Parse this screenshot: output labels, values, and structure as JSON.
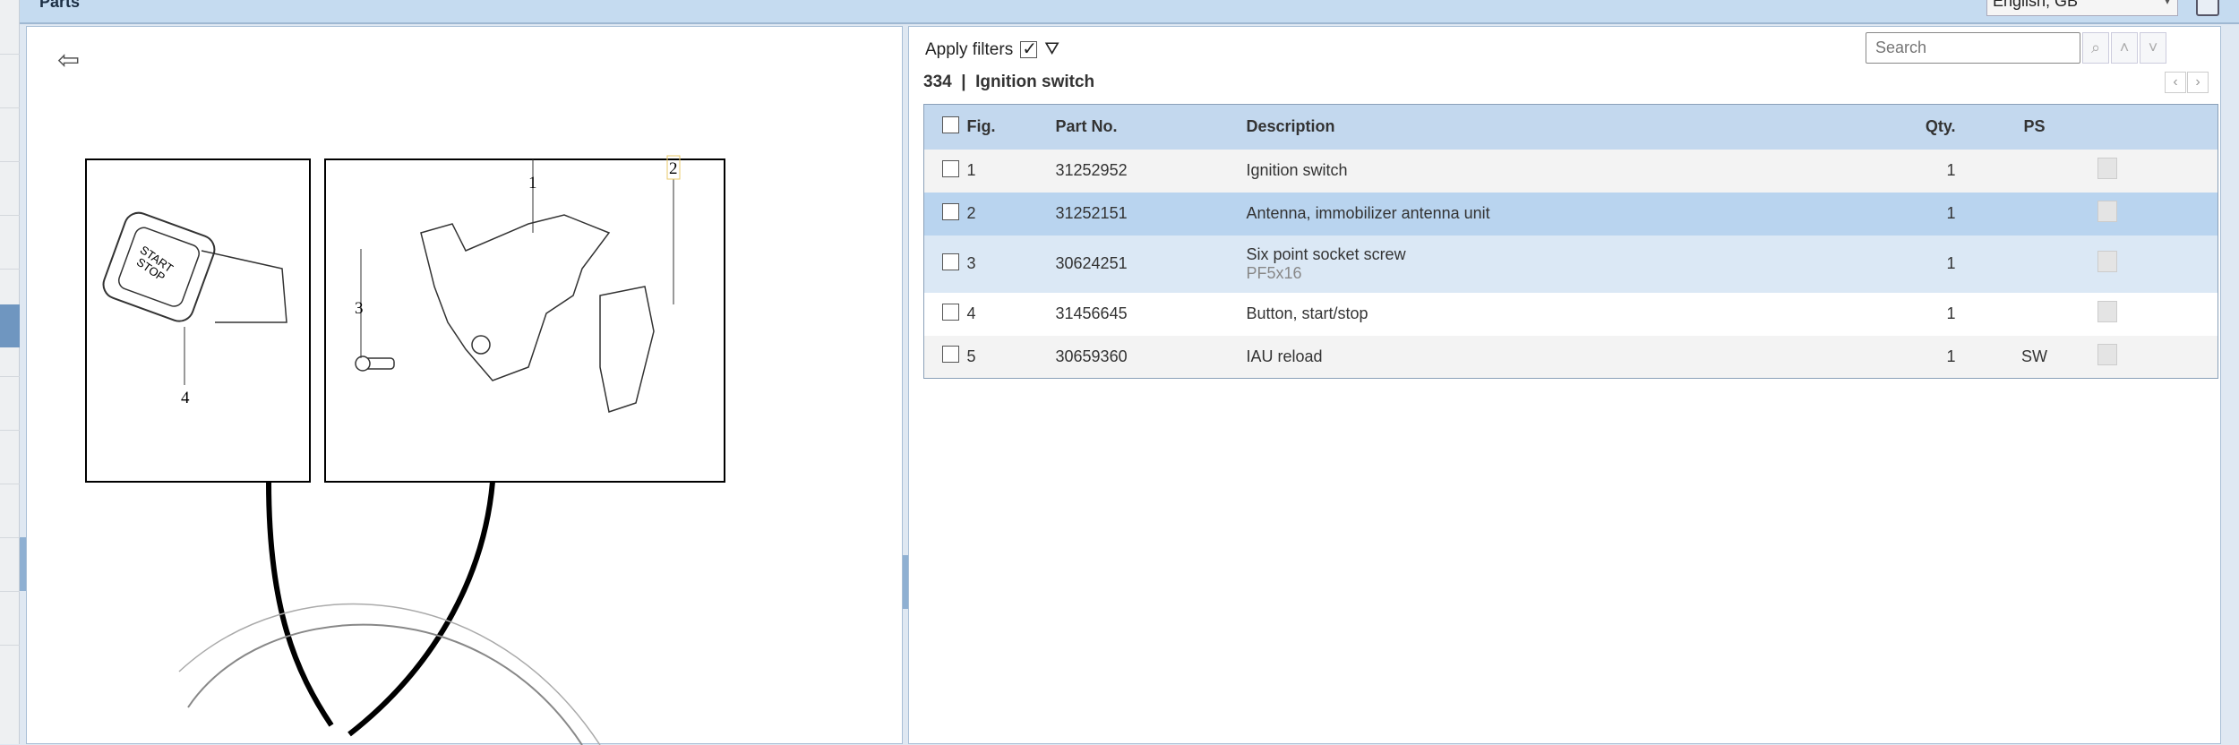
{
  "header": {
    "title": "Parts",
    "language": "English, GB"
  },
  "filters": {
    "label": "Apply filters",
    "checked": true
  },
  "section": {
    "heading": "334  |  Ignition switch"
  },
  "search": {
    "placeholder": "Search"
  },
  "table": {
    "columns": [
      "Fig.",
      "Part No.",
      "Description",
      "Qty.",
      "PS"
    ],
    "rows": [
      {
        "fig": "1",
        "part": "31252952",
        "desc": "Ignition switch",
        "sub": "",
        "qty": "1",
        "ps": ""
      },
      {
        "fig": "2",
        "part": "31252151",
        "desc": "Antenna, immobilizer antenna unit",
        "sub": "",
        "qty": "1",
        "ps": ""
      },
      {
        "fig": "3",
        "part": "30624251",
        "desc": "Six point socket screw",
        "sub": "PF5x16",
        "qty": "1",
        "ps": ""
      },
      {
        "fig": "4",
        "part": "31456645",
        "desc": "Button, start/stop",
        "sub": "",
        "qty": "1",
        "ps": ""
      },
      {
        "fig": "5",
        "part": "30659360",
        "desc": "IAU reload",
        "sub": "",
        "qty": "1",
        "ps": "SW"
      }
    ]
  },
  "diagram": {
    "labels": [
      "1",
      "2",
      "3",
      "4"
    ],
    "button_text": [
      "START",
      "STOP"
    ]
  }
}
